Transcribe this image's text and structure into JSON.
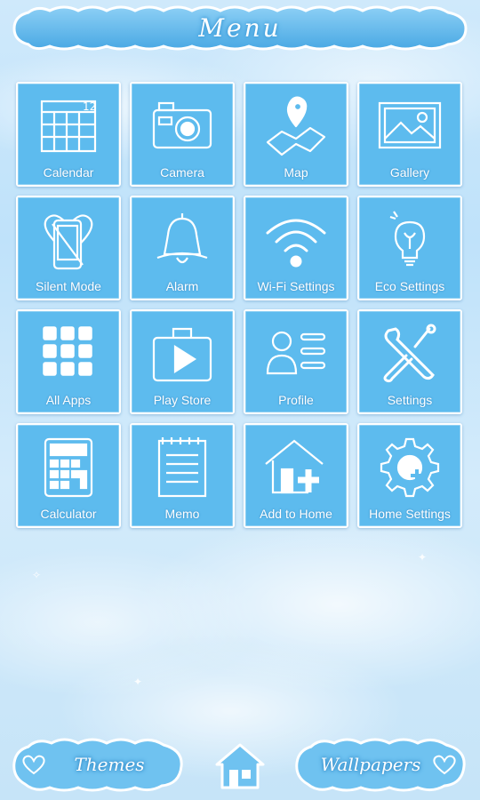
{
  "header": {
    "title": "Menu"
  },
  "tiles": [
    {
      "label": "Calendar",
      "icon": "calendar-icon"
    },
    {
      "label": "Camera",
      "icon": "camera-icon"
    },
    {
      "label": "Map",
      "icon": "map-icon"
    },
    {
      "label": "Gallery",
      "icon": "gallery-icon"
    },
    {
      "label": "Silent Mode",
      "icon": "silent-mode-icon"
    },
    {
      "label": "Alarm",
      "icon": "bell-icon"
    },
    {
      "label": "Wi-Fi Settings",
      "icon": "wifi-icon"
    },
    {
      "label": "Eco Settings",
      "icon": "lightbulb-icon"
    },
    {
      "label": "All Apps",
      "icon": "apps-grid-icon"
    },
    {
      "label": "Play Store",
      "icon": "play-store-icon"
    },
    {
      "label": "Profile",
      "icon": "profile-icon"
    },
    {
      "label": "Settings",
      "icon": "tools-icon"
    },
    {
      "label": "Calculator",
      "icon": "calculator-icon"
    },
    {
      "label": "Memo",
      "icon": "memo-icon"
    },
    {
      "label": "Add to Home",
      "icon": "house-plus-icon"
    },
    {
      "label": "Home Settings",
      "icon": "gear-plus-icon"
    }
  ],
  "bottom_bar": {
    "themes_label": "Themes",
    "wallpapers_label": "Wallpapers",
    "home_icon": "home-icon"
  },
  "colors": {
    "tile": "#5dbbee",
    "accent": "#3a9ad8",
    "background": "#cfe9fb"
  }
}
